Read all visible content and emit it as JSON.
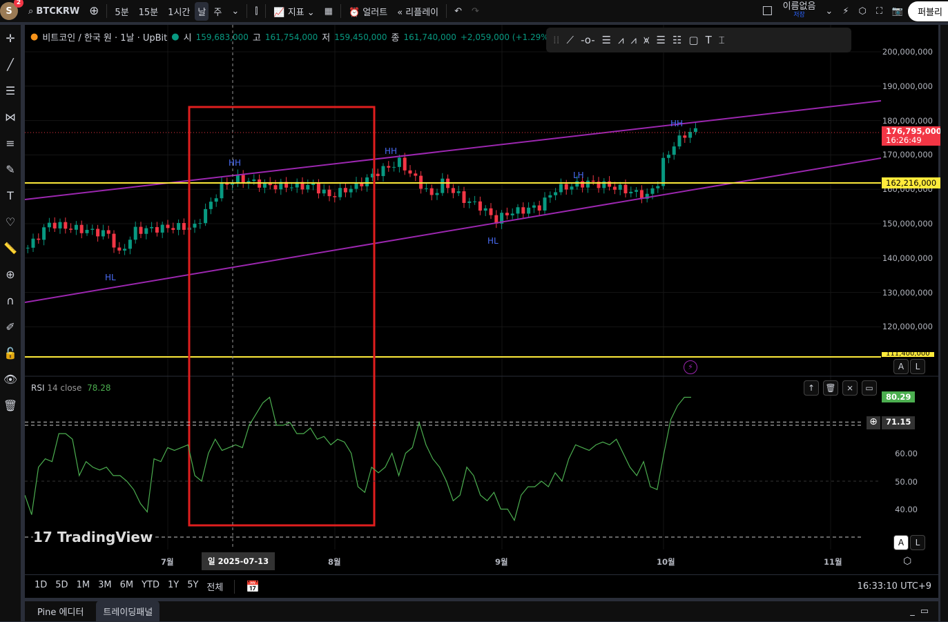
{
  "topbar": {
    "avatar": "S",
    "notifications": "2",
    "symbol": "BTCKRW",
    "intervals": [
      "5분",
      "15분",
      "1시간",
      "날",
      "주"
    ],
    "active_interval": "날",
    "indicators": "지표",
    "alerts": "얼러트",
    "replay": "리플레이",
    "layout_name": "이름없음",
    "save_status": "저장",
    "publish": "퍼블리"
  },
  "legend": {
    "title": "비트코인 / 한국 원 · 1날 · UpBit",
    "o_label": "시",
    "open": "159,683,000",
    "h_label": "고",
    "high": "161,754,000",
    "l_label": "저",
    "low": "159,450,000",
    "c_label": "종",
    "close": "161,740,000",
    "change": "+2,059,000 (+1.29%)"
  },
  "price_axis": [
    "200,000,000",
    "190,000,000",
    "180,000,000",
    "170,000,000",
    "160,000,000",
    "150,000,000",
    "140,000,000",
    "130,000,000",
    "120,000,000"
  ],
  "last_price": {
    "value": "176,795,000",
    "countdown": "16:26:49",
    "color": "#f23645"
  },
  "hline_price": {
    "value": "162,216,000",
    "color": "#ffeb3b"
  },
  "hline_low": {
    "value": "111,400,000"
  },
  "annotations": [
    "HH",
    "HL",
    "HH",
    "LH",
    "HL",
    "HH"
  ],
  "rsi": {
    "label": "RSI",
    "params": "14 close",
    "value": "78.28",
    "axis": [
      "60.00",
      "50.00",
      "40.00"
    ],
    "current": "80.29",
    "crosshair": "71.15",
    "color": "#4caf50"
  },
  "time_axis": [
    "7월",
    "8월",
    "9월",
    "10월",
    "11월"
  ],
  "crosshair_date": "일 2025-07-13",
  "ranges": [
    "1D",
    "5D",
    "1M",
    "3M",
    "6M",
    "YTD",
    "1Y",
    "5Y",
    "전체"
  ],
  "clock": "16:33:10 UTC+9",
  "watermark": "TradingView",
  "scale_buttons": {
    "auto": "A",
    "log": "L"
  },
  "panel_tabs": [
    "Pine 에디터",
    "트레이딩패널"
  ],
  "chart_data": {
    "type": "candlestick",
    "unit": "KRW (millions)",
    "ylim": [
      110,
      205
    ],
    "keypoints": [
      [
        "2025-06-05",
        143
      ],
      [
        "2025-06-09",
        150
      ],
      [
        "2025-06-12",
        149
      ],
      [
        "2025-06-20",
        147
      ],
      [
        "2025-06-22",
        141
      ],
      [
        "2025-06-25",
        148
      ],
      [
        "2025-07-02",
        149
      ],
      [
        "2025-07-06",
        149
      ],
      [
        "2025-07-09",
        156
      ],
      [
        "2025-07-11",
        161
      ],
      [
        "2025-07-14",
        163
      ],
      [
        "2025-07-20",
        161
      ],
      [
        "2025-07-28",
        161
      ],
      [
        "2025-07-31",
        158
      ],
      [
        "2025-08-05",
        161
      ],
      [
        "2025-08-09",
        165
      ],
      [
        "2025-08-13",
        168
      ],
      [
        "2025-08-16",
        163
      ],
      [
        "2025-08-19",
        158
      ],
      [
        "2025-08-21",
        162
      ],
      [
        "2025-08-25",
        157
      ],
      [
        "2025-08-28",
        155
      ],
      [
        "2025-08-31",
        151
      ],
      [
        "2025-09-02",
        153
      ],
      [
        "2025-09-08",
        155
      ],
      [
        "2025-09-11",
        160
      ],
      [
        "2025-09-17",
        162
      ],
      [
        "2025-09-21",
        161
      ],
      [
        "2025-09-28",
        158
      ],
      [
        "2025-09-30",
        162
      ],
      [
        "2025-10-01",
        168
      ],
      [
        "2025-10-03",
        173
      ],
      [
        "2025-10-05",
        176
      ],
      [
        "2025-10-07",
        177
      ]
    ],
    "rsi_values": [
      45,
      38,
      55,
      58,
      57,
      67,
      67,
      65,
      52,
      57,
      55,
      54,
      55,
      52,
      52,
      50,
      47,
      42,
      39,
      58,
      57,
      62,
      61,
      62,
      63,
      52,
      50,
      60,
      65,
      61,
      62,
      63,
      62,
      70,
      74,
      78,
      80,
      70,
      70,
      71,
      67,
      67,
      69,
      65,
      66,
      63,
      65,
      64,
      60,
      48,
      46,
      55,
      53,
      55,
      60,
      52,
      60,
      62,
      71,
      63,
      58,
      55,
      50,
      43,
      45,
      55,
      52,
      45,
      43,
      46,
      40,
      40,
      36,
      45,
      48,
      48,
      50,
      48,
      53,
      50,
      58,
      63,
      62,
      61,
      63,
      64,
      63,
      65,
      60,
      55,
      52,
      57,
      48,
      47,
      60,
      72,
      77,
      80,
      80
    ]
  }
}
